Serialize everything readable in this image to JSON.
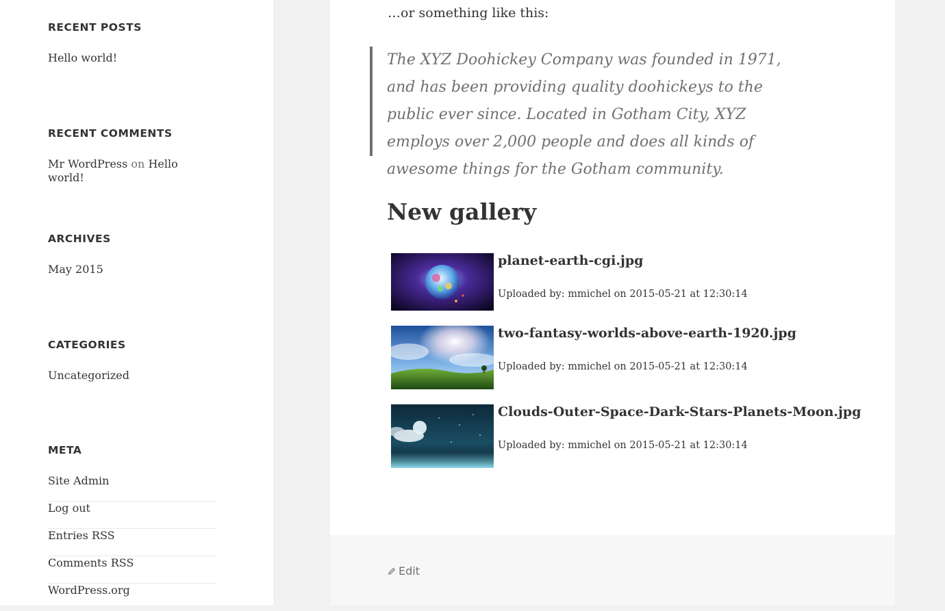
{
  "sidebar": {
    "recent_posts": {
      "title": "RECENT POSTS",
      "items": [
        "Hello world!"
      ]
    },
    "recent_comments": {
      "title": "RECENT COMMENTS",
      "author": "Mr WordPress",
      "connector": "on",
      "post": "Hello world!"
    },
    "archives": {
      "title": "ARCHIVES",
      "items": [
        "May 2015"
      ]
    },
    "categories": {
      "title": "CATEGORIES",
      "items": [
        "Uncategorized"
      ]
    },
    "meta": {
      "title": "META",
      "items": [
        "Site Admin",
        "Log out",
        "Entries RSS",
        "Comments RSS",
        "WordPress.org"
      ]
    }
  },
  "main": {
    "lead": "…or something like this:",
    "quote": "The XYZ Doohickey Company was founded in 1971, and has been providing quality doohickeys to the public ever since. Located in Gotham City, XYZ employs over 2,000 people and does all kinds of awesome things for the Gotham community.",
    "gallery_title": "New gallery",
    "gallery": [
      {
        "title": "planet-earth-cgi.jpg",
        "meta": "Uploaded by: mmichel on 2015-05-21 at 12:30:14"
      },
      {
        "title": "two-fantasy-worlds-above-earth-1920.jpg",
        "meta": "Uploaded by: mmichel on 2015-05-21 at 12:30:14"
      },
      {
        "title": "Clouds-Outer-Space-Dark-Stars-Planets-Moon.jpg",
        "meta": "Uploaded by: mmichel on 2015-05-21 at 12:30:14"
      }
    ],
    "edit_label": "Edit",
    "edit_icon": "pencil-icon"
  }
}
